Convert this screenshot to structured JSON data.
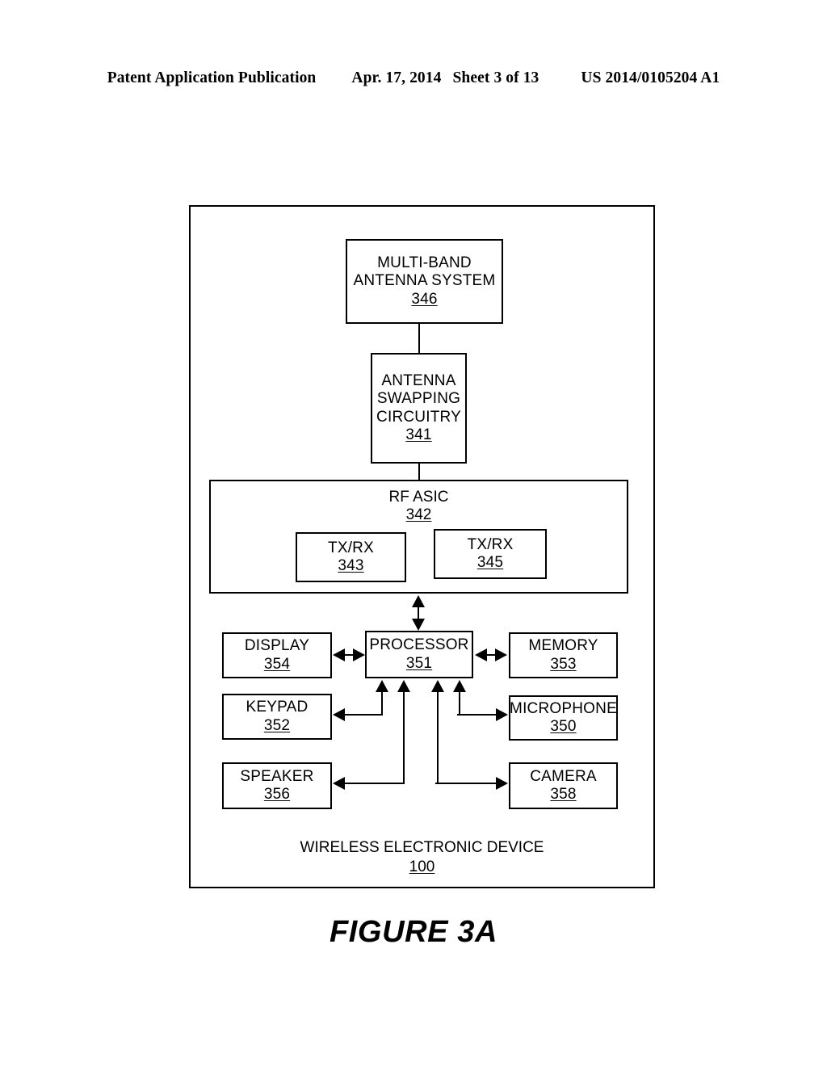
{
  "header": {
    "publication": "Patent Application Publication",
    "date": "Apr. 17, 2014",
    "sheet": "Sheet 3 of 13",
    "patent_number": "US 2014/0105204 A1"
  },
  "figure": {
    "title": "FIGURE 3A",
    "device": {
      "label": "WIRELESS ELECTRONIC DEVICE",
      "ref": "100"
    },
    "blocks": {
      "antenna_system": {
        "line1": "MULTI-BAND",
        "line2": "ANTENNA SYSTEM",
        "ref": "346"
      },
      "antenna_swapping": {
        "line1": "ANTENNA",
        "line2": "SWAPPING",
        "line3": "CIRCUITRY",
        "ref": "341"
      },
      "rf_asic": {
        "label": "RF ASIC",
        "ref": "342"
      },
      "txrx_left": {
        "label": "TX/RX",
        "ref": "343"
      },
      "txrx_right": {
        "label": "TX/RX",
        "ref": "345"
      },
      "display": {
        "label": "DISPLAY",
        "ref": "354"
      },
      "processor": {
        "label": "PROCESSOR",
        "ref": "351"
      },
      "memory": {
        "label": "MEMORY",
        "ref": "353"
      },
      "keypad": {
        "label": "KEYPAD",
        "ref": "352"
      },
      "microphone": {
        "label": "MICROPHONE",
        "ref": "350"
      },
      "speaker": {
        "label": "SPEAKER",
        "ref": "356"
      },
      "camera": {
        "label": "CAMERA",
        "ref": "358"
      }
    }
  }
}
